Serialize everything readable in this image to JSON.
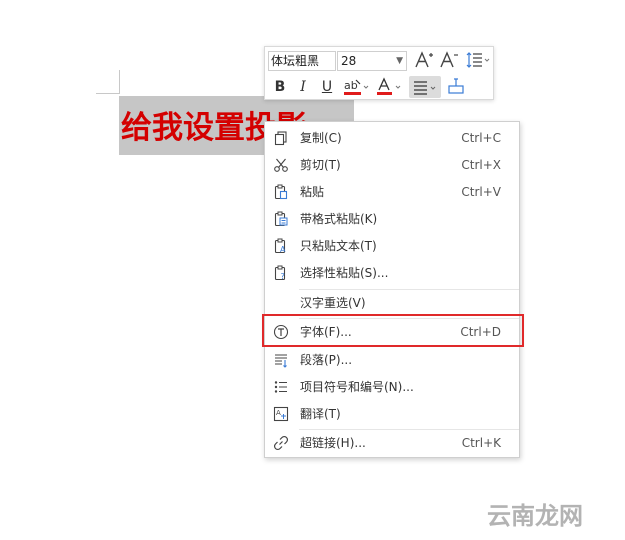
{
  "document": {
    "selected_text": "给我设置投影"
  },
  "mini_toolbar": {
    "font_name": "体坛粗黑",
    "font_size": "28",
    "buttons": {
      "grow_font": "A",
      "shrink_font": "A",
      "bold": "B",
      "italic": "I",
      "underline": "U",
      "font_color": "A"
    }
  },
  "context_menu": {
    "items": [
      {
        "label": "复制(C)",
        "shortcut": "Ctrl+C",
        "icon": "copy-icon"
      },
      {
        "label": "剪切(T)",
        "shortcut": "Ctrl+X",
        "icon": "scissors-icon"
      },
      {
        "label": "粘贴",
        "shortcut": "Ctrl+V",
        "icon": "paste-icon"
      },
      {
        "label": "带格式粘贴(K)",
        "shortcut": "",
        "icon": "paste-formatted-icon"
      },
      {
        "label": "只粘贴文本(T)",
        "shortcut": "",
        "icon": "paste-text-icon"
      },
      {
        "label": "选择性粘贴(S)...",
        "shortcut": "",
        "icon": "paste-special-icon"
      },
      {
        "label": "汉字重选(V)",
        "shortcut": "",
        "icon": ""
      },
      {
        "label": "字体(F)...",
        "shortcut": "Ctrl+D",
        "icon": "font-icon"
      },
      {
        "label": "段落(P)...",
        "shortcut": "",
        "icon": "paragraph-icon"
      },
      {
        "label": "项目符号和编号(N)...",
        "shortcut": "",
        "icon": "bullets-icon"
      },
      {
        "label": "翻译(T)",
        "shortcut": "",
        "icon": "translate-icon"
      },
      {
        "label": "超链接(H)...",
        "shortcut": "Ctrl+K",
        "icon": "link-icon"
      }
    ]
  },
  "colors": {
    "selected_text": "#d40000",
    "highlight_border": "#e0292a",
    "selection_background": "#c6c6c6"
  },
  "watermark": "云南龙网"
}
